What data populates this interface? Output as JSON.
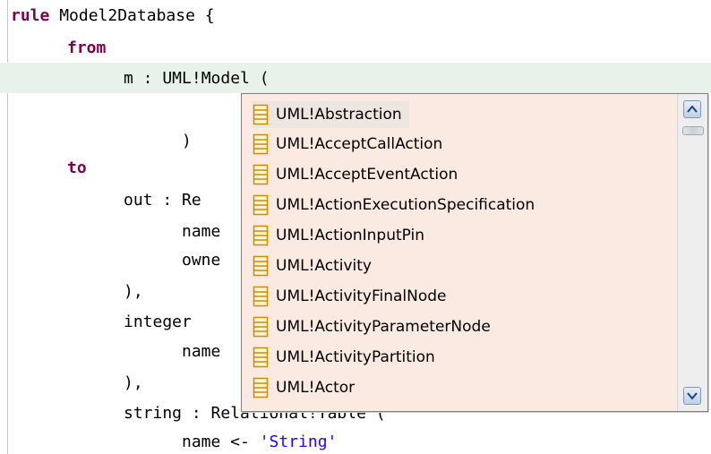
{
  "editor": {
    "lines": [
      {
        "keyword": "rule",
        "text": " Model2Database {"
      },
      {
        "keyword": "from",
        "text": ""
      },
      {
        "text": "m : UML!Model ("
      },
      {
        "text": ""
      },
      {
        "text": ")"
      },
      {
        "keyword": "to",
        "text": ""
      },
      {
        "text": "out : Re"
      },
      {
        "text": "name"
      },
      {
        "text": "owne"
      },
      {
        "text": "),"
      },
      {
        "text": "integer"
      },
      {
        "text": "name"
      },
      {
        "text": "),"
      },
      {
        "text": "string : Relational!Table ("
      },
      {
        "text": "name <- ",
        "string": "'String'"
      }
    ],
    "highlight_color": "#e8f2ea",
    "keyword_color": "#7f0055",
    "string_color": "#2a00ff"
  },
  "content_assist": {
    "items": [
      {
        "icon": "table-icon",
        "label": "UML!Abstraction",
        "selected": true
      },
      {
        "icon": "table-icon",
        "label": "UML!AcceptCallAction"
      },
      {
        "icon": "table-icon",
        "label": "UML!AcceptEventAction"
      },
      {
        "icon": "table-icon",
        "label": "UML!ActionExecutionSpecification"
      },
      {
        "icon": "table-icon",
        "label": "UML!ActionInputPin"
      },
      {
        "icon": "table-icon",
        "label": "UML!Activity"
      },
      {
        "icon": "table-icon",
        "label": "UML!ActivityFinalNode"
      },
      {
        "icon": "table-icon",
        "label": "UML!ActivityParameterNode"
      },
      {
        "icon": "table-icon",
        "label": "UML!ActivityPartition"
      },
      {
        "icon": "table-icon",
        "label": "UML!Actor"
      }
    ],
    "background": "#fbeae2",
    "scroll_position": 0
  }
}
